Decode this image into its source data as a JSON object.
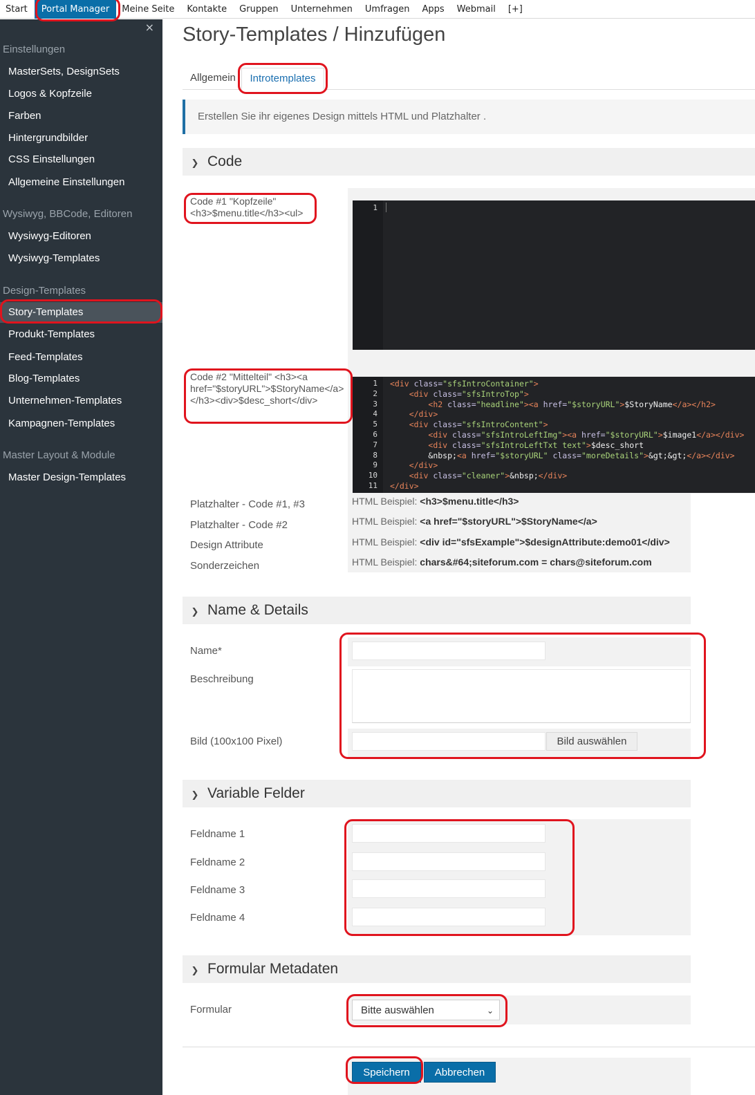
{
  "topnav": {
    "items": [
      "Start",
      "Portal Manager",
      "Meine Seite",
      "Kontakte",
      "Gruppen",
      "Unternehmen",
      "Umfragen",
      "Apps",
      "Webmail",
      "[+]"
    ]
  },
  "sidebar": {
    "close": "×",
    "sections": [
      {
        "title": "Einstellungen",
        "items": [
          "MasterSets, DesignSets",
          "Logos & Kopfzeile",
          "Farben",
          "Hintergrundbilder",
          "CSS Einstellungen",
          "Allgemeine Einstellungen"
        ]
      },
      {
        "title": "Wysiwyg, BBCode, Editoren",
        "items": [
          "Wysiwyg-Editoren",
          "Wysiwyg-Templates"
        ]
      },
      {
        "title": "Design-Templates",
        "items": [
          "Story-Templates",
          "Produkt-Templates",
          "Feed-Templates",
          "Blog-Templates",
          "Unternehmen-Templates",
          "Kampagnen-Templates"
        ]
      },
      {
        "title": "Master Layout & Module",
        "items": [
          "Master Design-Templates"
        ]
      }
    ]
  },
  "main": {
    "title": "Story-Templates / Hinzufügen",
    "tabs": [
      "Allgemein",
      "Introtemplates"
    ],
    "info": "Erstellen Sie ihr eigenes Design mittels HTML und Platzhalter .",
    "code_section": {
      "heading": "Code",
      "code1_label": "Code #1 \"Kopfzeile\" <h3>$menu.title</h3><ul>",
      "code2_label": "Code #2 \"Mittelteil\" <h3><a href=\"$storyURL\">$StoryName</a></h3><div>$desc_short</div>",
      "editor1_line": "1",
      "editor2_lines": [
        "<div class=\"sfsIntroContainer\">",
        "    <div class=\"sfsIntroTop\">",
        "        <h2 class=\"headline\"><a href=\"$storyURL\">$StoryName</a></h2>",
        "    </div>",
        "    <div class=\"sfsIntroContent\">",
        "        <div class=\"sfsIntroLeftImg\"><a href=\"$storyURL\">$image1</a></div>",
        "        <div class=\"sfsIntroLeftTxt text\">$desc_short",
        "        &nbsp;<a href=\"$storyURL\" class=\"moreDetails\">&gt;&gt;</a></div>",
        "    </div>",
        "    <div class=\"cleaner\">&nbsp;</div>",
        "</div>"
      ],
      "placeholders": [
        {
          "label": "Platzhalter - Code #1, #3",
          "prefix": "HTML Beispiel:",
          "example": "<h3>$menu.title</h3>"
        },
        {
          "label": "Platzhalter - Code #2",
          "prefix": "HTML Beispiel:",
          "example": "<a href=\"$storyURL\">$StoryName</a>"
        },
        {
          "label": "Design Attribute",
          "prefix": "HTML Beispiel:",
          "example": "<div id=\"sfsExample\">$designAttribute:demo01</div>"
        },
        {
          "label": "Sonderzeichen",
          "prefix": "HTML Beispiel:",
          "example": "chars&#64;siteforum.com = chars@siteforum.com"
        }
      ]
    },
    "name_section": {
      "heading": "Name & Details",
      "name_label": "Name*",
      "desc_label": "Beschreibung",
      "image_label": "Bild (100x100 Pixel)",
      "image_button": "Bild auswählen"
    },
    "vars_section": {
      "heading": "Variable Felder",
      "fields": [
        "Feldname 1",
        "Feldname 2",
        "Feldname 3",
        "Feldname 4"
      ]
    },
    "meta_section": {
      "heading": "Formular Metadaten",
      "form_label": "Formular",
      "form_select": "Bitte auswählen"
    },
    "buttons": {
      "save": "Speichern",
      "cancel": "Abbrechen"
    }
  },
  "colors": {
    "accent": "#0a6ea8",
    "sidebar": "#2b343c",
    "highlight": "#e0141e"
  }
}
